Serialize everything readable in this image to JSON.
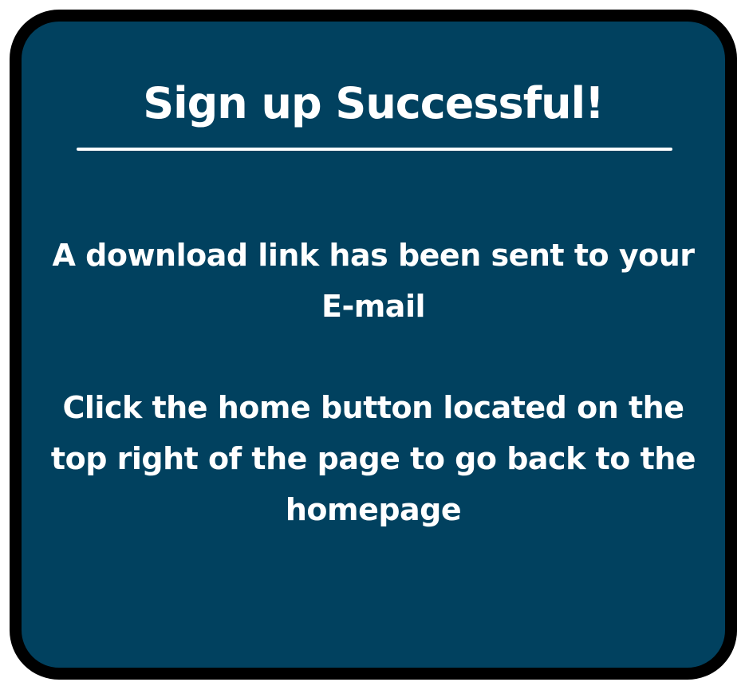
{
  "dialog": {
    "title": "Sign up Successful!",
    "message_download": "A download link has been sent to your E-mail",
    "message_home": "Click the home button located on the top right of the page to go back to the homepage"
  },
  "colors": {
    "card_background": "#01415f",
    "card_border": "#000000",
    "text": "#ffffff"
  }
}
